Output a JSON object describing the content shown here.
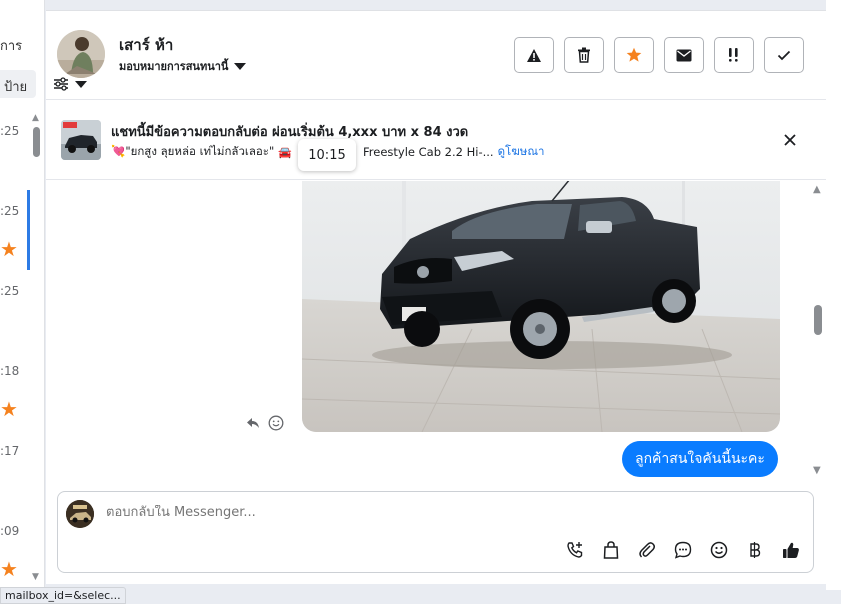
{
  "left_list": {
    "top_text": "การ",
    "tag_text": "ป้าย",
    "times": [
      ":25",
      ":25",
      ":25",
      ":18",
      ":17",
      ":09"
    ]
  },
  "header": {
    "contact_name": "เสาร์ ห้า",
    "assign_label": "มอบหมายการสนทนานี้"
  },
  "actions": [
    "spam-icon",
    "trash-icon",
    "star-icon",
    "mail-icon",
    "important-icon",
    "check-icon"
  ],
  "ad": {
    "title": "แชทนี้มีข้อความตอบกลับต่อ ผ่อนเริ่มต้น 4,xxx บาท x 84 งวด",
    "subtitle_start": "💘\"ยกสูง ลุยหล่อ เท่ไม่กลัวเลอะ\"",
    "subtitle_end": "Freestyle Cab 2.2 Hi-...",
    "link": "ดูโฆษณา",
    "tooltip_time": "10:15"
  },
  "messages": {
    "outgoing_text": "ลูกค้าสนใจคันนี้นะคะ"
  },
  "composer": {
    "placeholder": "ตอบกลับใน Messenger..."
  },
  "tools": [
    "call-plus-icon",
    "bag-icon",
    "paperclip-icon",
    "chat-bubble-icon",
    "smiley-icon",
    "baht-icon",
    "thumbs-up-icon"
  ],
  "status_url": "mailbox_id=&selec...",
  "colors": {
    "accent_blue": "#0a7cff",
    "star_orange": "#f5821f",
    "link_blue": "#1b74e4"
  }
}
